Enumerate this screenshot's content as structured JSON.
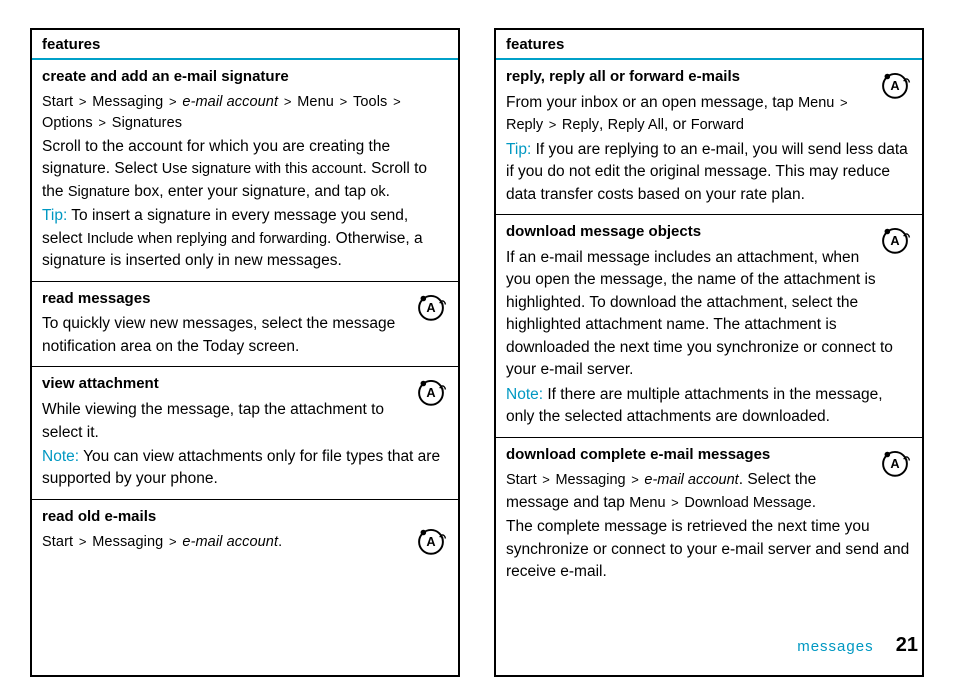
{
  "header": "features",
  "footer": {
    "section": "messages",
    "page": "21"
  },
  "left": {
    "s1": {
      "title": "create and add an e-mail signature",
      "nav_start": "Start",
      "nav_messaging": "Messaging",
      "nav_account": "e-mail account",
      "nav_menu": "Menu",
      "nav_tools": "Tools",
      "nav_options": "Options",
      "nav_signatures": "Signatures",
      "body1a": "Scroll to the account for which you are creating the signature. Select ",
      "body1b": "Use signature with this account",
      "body1c": ". Scroll to the ",
      "body1d": "Signature",
      "body1e": " box, enter your signature, and tap ",
      "body1f": "ok",
      "body1g": ".",
      "tip_label": "Tip:",
      "tip_a": " To insert a signature in every message you send, select ",
      "tip_b": "Include when replying and forwarding",
      "tip_c": ". Otherwise, a signature is inserted only in new messages."
    },
    "s2": {
      "title": "read messages",
      "body": "To quickly view new messages, select the message notification area on the Today screen."
    },
    "s3": {
      "title": "view attachment",
      "body": "While viewing the message, tap the attachment to select it.",
      "note_label": "Note:",
      "note_body": " You can view attachments only for file types that are supported by your phone."
    },
    "s4": {
      "title": "read old e-mails",
      "nav_start": "Start",
      "nav_messaging": "Messaging",
      "nav_account": "e-mail account",
      "nav_end": "."
    }
  },
  "right": {
    "s1": {
      "title": "reply, reply all or forward e-mails",
      "body_a": "From your inbox or an open message, tap ",
      "nav_menu": "Menu",
      "nav_reply1": "Reply",
      "nav_reply2": "Reply",
      "nav_replyall": "Reply All",
      "nav_or": ", or ",
      "nav_forward": "Forward",
      "tip_label": "Tip:",
      "tip_body": " If you are replying to an e-mail, you will send less data if you do not edit the original message. This may reduce data transfer costs based on your rate plan."
    },
    "s2": {
      "title": "download message objects",
      "body": "If an e-mail message includes an attachment, when you open the message, the name of the attachment is highlighted. To download the attachment, select the highlighted attachment name. The attachment is downloaded the next time you synchronize or connect to your e-mail server.",
      "note_label": "Note:",
      "note_body": " If there are multiple attachments in the message, only the selected attachments are downloaded."
    },
    "s3": {
      "title": "download complete e-mail messages",
      "nav_start": "Start",
      "nav_messaging": "Messaging",
      "nav_account": "e-mail account",
      "body_a": ". Select the message and tap ",
      "nav_menu": "Menu",
      "nav_download": "Download Message",
      "body_b": ".",
      "body2": "The complete message is retrieved the next time you synchronize or connect to your e-mail server and send and receive e-mail."
    }
  }
}
